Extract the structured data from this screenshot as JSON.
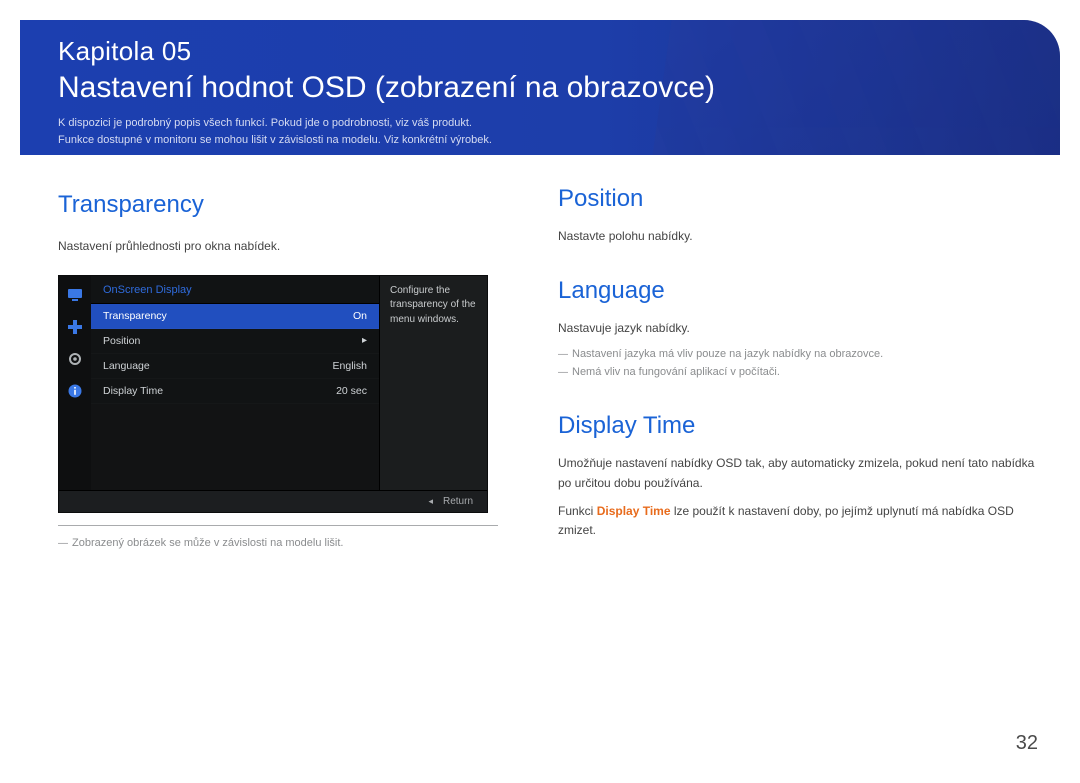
{
  "banner": {
    "chapter_label": "Kapitola 05",
    "title": "Nastavení hodnot OSD (zobrazení na obrazovce)",
    "desc1": "K dispozici je podrobný popis všech funkcí. Pokud jde o podrobnosti, viz váš produkt.",
    "desc2": "Funkce dostupné v monitoru se mohou lišit v závislosti na modelu. Viz konkrétní výrobek."
  },
  "left": {
    "transparency_title": "Transparency",
    "transparency_desc": "Nastavení průhlednosti pro okna nabídek.",
    "img_note": "Zobrazený obrázek se může v závislosti na modelu lišit."
  },
  "osd": {
    "header": "OnScreen Display",
    "rows": [
      {
        "label": "Transparency",
        "value": "On",
        "selected": true,
        "arrow": false
      },
      {
        "label": "Position",
        "value": "",
        "selected": false,
        "arrow": true
      },
      {
        "label": "Language",
        "value": "English",
        "selected": false,
        "arrow": false
      },
      {
        "label": "Display Time",
        "value": "20 sec",
        "selected": false,
        "arrow": false
      }
    ],
    "helper": "Configure the transparency of the menu windows.",
    "footer_return": "Return"
  },
  "right": {
    "position_title": "Position",
    "position_desc": "Nastavte polohu nabídky.",
    "language_title": "Language",
    "language_desc": "Nastavuje jazyk nabídky.",
    "language_note1": "Nastavení jazyka má vliv pouze na jazyk nabídky na obrazovce.",
    "language_note2": "Nemá vliv na fungování aplikací v počítači.",
    "display_time_title": "Display Time",
    "display_time_desc": "Umožňuje nastavení nabídky OSD tak, aby automaticky zmizela, pokud není tato nabídka po určitou dobu používána.",
    "display_time_pre": "Funkci ",
    "display_time_strong": "Display Time",
    "display_time_post": " lze použít k nastavení doby, po jejímž uplynutí má nabídka OSD zmizet."
  },
  "page_number": "32"
}
